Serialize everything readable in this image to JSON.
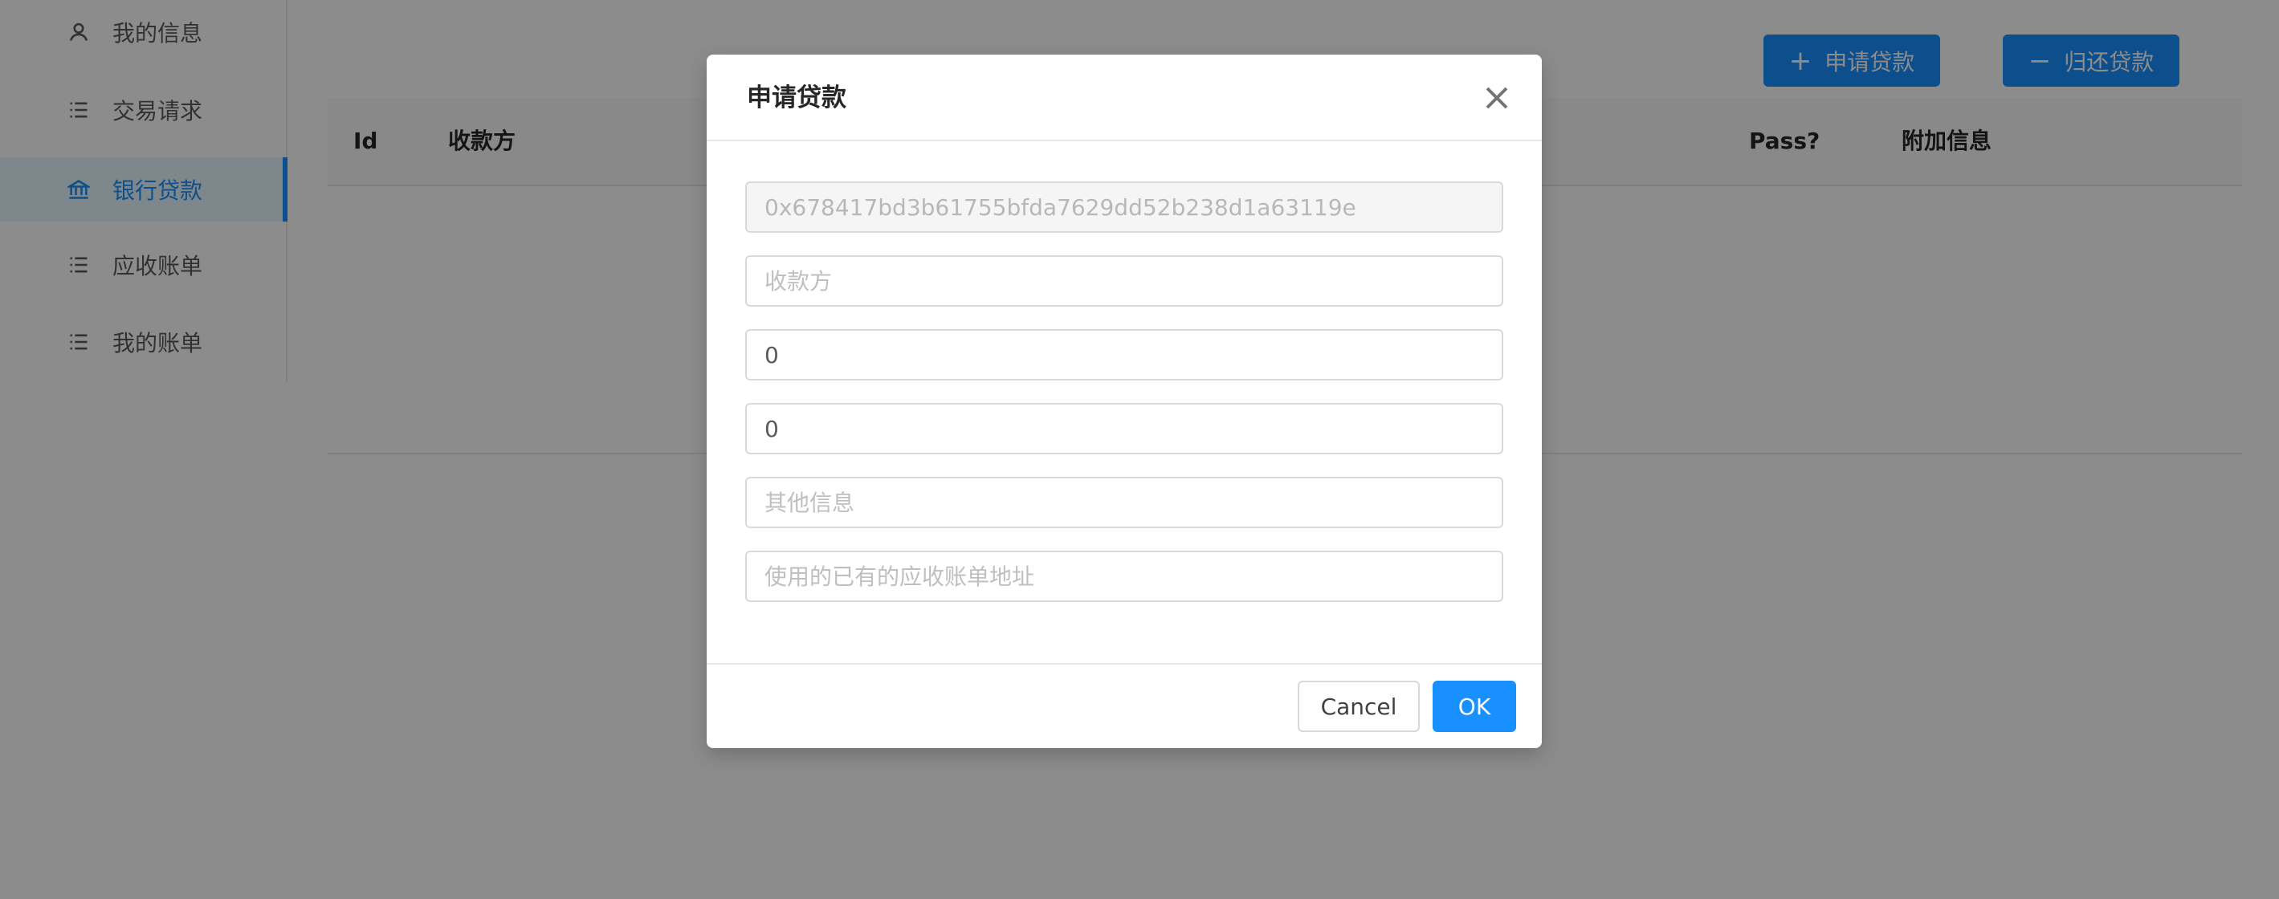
{
  "sidebar": {
    "items": [
      {
        "label": "我的信息",
        "icon": "user-icon"
      },
      {
        "label": "交易请求",
        "icon": "list-icon"
      },
      {
        "label": "银行贷款",
        "icon": "bank-icon",
        "selected": true
      },
      {
        "label": "应收账单",
        "icon": "list-icon"
      },
      {
        "label": "我的账单",
        "icon": "list-icon"
      }
    ]
  },
  "toolbar": {
    "apply_label": "申请贷款",
    "repay_label": "归还贷款"
  },
  "table": {
    "columns": [
      "Id",
      "收款方",
      "Pass?",
      "附加信息"
    ]
  },
  "modal": {
    "title": "申请贷款",
    "fields": [
      {
        "value": "0x678417bd3b61755bfda7629dd52b238d1a63119e",
        "placeholder": "",
        "disabled": true
      },
      {
        "value": "",
        "placeholder": "收款方"
      },
      {
        "value": "0",
        "placeholder": ""
      },
      {
        "value": "0",
        "placeholder": ""
      },
      {
        "value": "",
        "placeholder": "其他信息"
      },
      {
        "value": "",
        "placeholder": "使用的已有的应收账单地址"
      }
    ],
    "cancel_label": "Cancel",
    "ok_label": "OK"
  },
  "colors": {
    "primary": "#1890ff",
    "mask": "rgba(0,0,0,0.45)"
  }
}
